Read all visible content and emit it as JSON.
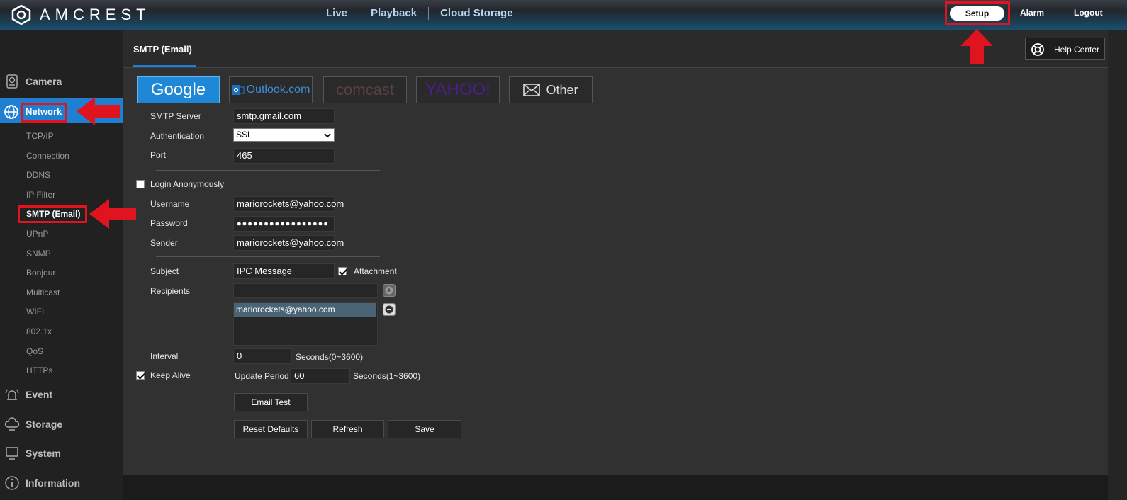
{
  "header": {
    "brand": "AMCREST",
    "nav": [
      "Live",
      "Playback",
      "Cloud Storage"
    ],
    "setup_label": "Setup",
    "alarm_label": "Alarm",
    "logout_label": "Logout"
  },
  "sidebar": {
    "camera": "Camera",
    "network": "Network",
    "sub_items": [
      "TCP/IP",
      "Connection",
      "DDNS",
      "IP Filter",
      "SMTP (Email)",
      "UPnP",
      "SNMP",
      "Bonjour",
      "Multicast",
      "WIFI",
      "802.1x",
      "QoS",
      "HTTPs"
    ],
    "event": "Event",
    "storage": "Storage",
    "system": "System",
    "information": "Information"
  },
  "page": {
    "tab_title": "SMTP (Email)",
    "help_label": "Help Center"
  },
  "providers": {
    "google": "Google",
    "outlook": "Outlook.com",
    "comcast": "comcast",
    "yahoo": "YAHOO!",
    "other": "Other"
  },
  "form": {
    "smtp_server_label": "SMTP Server",
    "smtp_server_value": "smtp.gmail.com",
    "auth_label": "Authentication",
    "auth_value": "SSL",
    "port_label": "Port",
    "port_value": "465",
    "login_anon_label": "Login Anonymously",
    "username_label": "Username",
    "username_value": "mariorockets@yahoo.com",
    "password_label": "Password",
    "password_value": "●●●●●●●●●●●●●●●●●",
    "sender_label": "Sender",
    "sender_value": "mariorockets@yahoo.com",
    "subject_label": "Subject",
    "subject_value": "IPC Message",
    "attachment_label": "Attachment",
    "recipients_label": "Recipients",
    "recipient_entry": "mariorockets@yahoo.com",
    "interval_label": "Interval",
    "interval_value": "0",
    "interval_unit": "Seconds(0~3600)",
    "keep_alive_label": "Keep Alive",
    "update_period_label": "Update Period",
    "update_period_value": "60",
    "update_period_unit": "Seconds(1~3600)",
    "email_test": "Email Test",
    "reset_defaults": "Reset Defaults",
    "refresh": "Refresh",
    "save": "Save"
  },
  "colors": {
    "accent": "#1f7fd1",
    "highlight": "#e0141e"
  }
}
